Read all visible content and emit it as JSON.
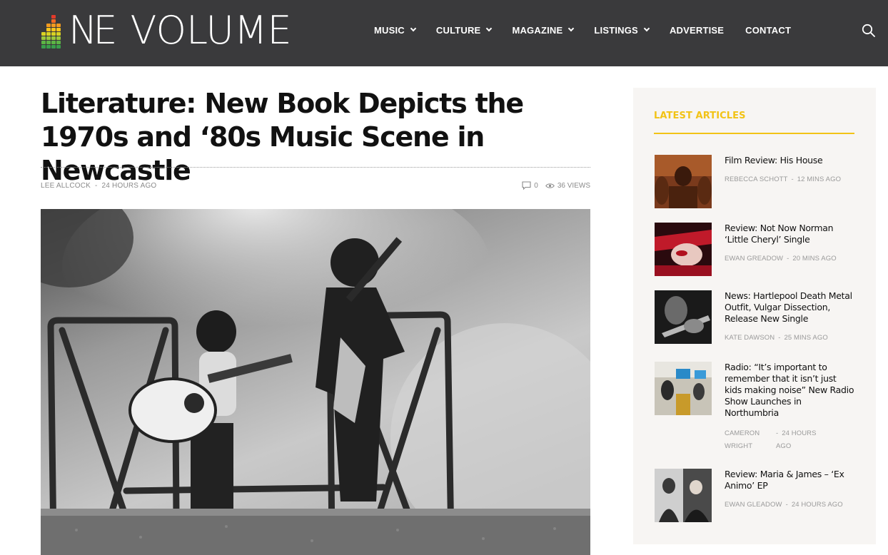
{
  "logo": {
    "ne": "NE",
    "volume": "VOLUME"
  },
  "nav": [
    {
      "label": "MUSIC",
      "dropdown": true
    },
    {
      "label": "CULTURE",
      "dropdown": true
    },
    {
      "label": "MAGAZINE",
      "dropdown": true
    },
    {
      "label": "LISTINGS",
      "dropdown": true
    },
    {
      "label": "ADVERTISE",
      "dropdown": false
    },
    {
      "label": "CONTACT",
      "dropdown": false
    }
  ],
  "article": {
    "title": "Literature: New Book Depicts the 1970s and ‘80s Music Scene in Newcastle",
    "author": "LEE ALLCOCK",
    "date": "24 HOURS AGO",
    "comments": "0",
    "views": "36 VIEWS"
  },
  "sidebar": {
    "heading": "LATEST ARTICLES",
    "articles": [
      {
        "title": "Film Review: His House",
        "author": "REBECCA SCHOTT",
        "time": "12 MINS AGO"
      },
      {
        "title": "Review: Not Now Norman ‘Little Cheryl’ Single",
        "author": "EWAN GREADOW",
        "time": "20 MINS AGO"
      },
      {
        "title": "News: Hartlepool Death Metal Outfit, Vulgar Dissection, Release New Single",
        "author": "KATE DAWSON",
        "time": "25 MINS AGO"
      },
      {
        "title": "Radio: “It’s important to remember that it isn’t just kids making noise” New Radio Show Launches in Northumbria",
        "author": "CAMERON WRIGHT",
        "time": "24 HOURS AGO"
      },
      {
        "title": "Review: Maria & James – ‘Ex Animo’ EP",
        "author": "EWAN GLEADOW",
        "time": "24 HOURS AGO"
      }
    ]
  },
  "colors": {
    "header_bg": "#3a3a3c",
    "accent": "#f2c316",
    "sidebar_bg": "#f7f5f3"
  }
}
